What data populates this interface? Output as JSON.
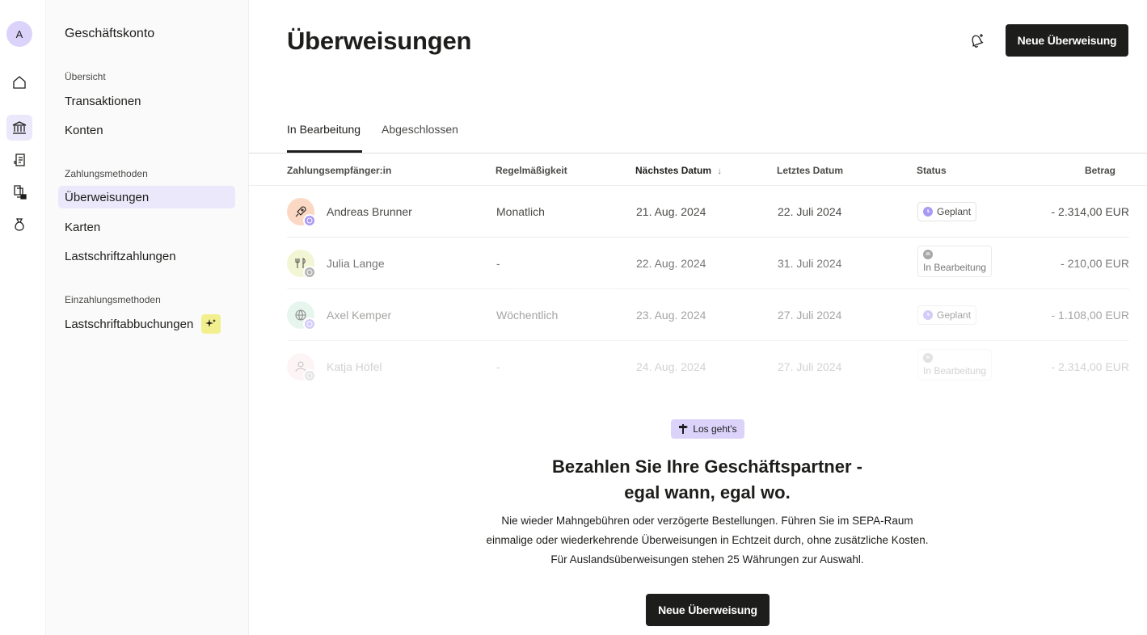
{
  "rail": {
    "avatar_initial": "A",
    "items": [
      {
        "name": "home-icon",
        "active": false
      },
      {
        "name": "bank-icon",
        "active": true
      },
      {
        "name": "invoice-icon",
        "active": false
      },
      {
        "name": "documents-lock-icon",
        "active": false
      },
      {
        "name": "money-bag-icon",
        "active": false
      }
    ]
  },
  "sidebar": {
    "title": "Geschäftskonto",
    "section_overview": "Übersicht",
    "item_transactions": "Transaktionen",
    "item_accounts": "Konten",
    "section_payment": "Zahlungsmethoden",
    "item_transfers": "Überweisungen",
    "item_cards": "Karten",
    "item_direct_debits": "Lastschriftzahlungen",
    "section_deposit": "Einzahlungsmethoden",
    "item_debit_collections": "Lastschriftabbuchungen",
    "new_badge_icon": "sparkle-icon"
  },
  "header": {
    "title": "Überweisungen",
    "new_transfer_label": "Neue Überweisung",
    "bell_icon": "bell-plus-icon"
  },
  "tabs": {
    "in_progress": "In Bearbeitung",
    "completed": "Abgeschlossen"
  },
  "table": {
    "columns": {
      "recipient": "Zahlungsempfänger:in",
      "frequency": "Regelmäßigkeit",
      "next_date": "Nächstes Datum",
      "sort_indicator": "↓",
      "last_date": "Letztes Datum",
      "status": "Status",
      "amount": "Betrag"
    },
    "rows": [
      {
        "name": "Andreas Brunner",
        "frequency": "Monatlich",
        "next": "21. Aug. 2024",
        "last": "22. Juli 2024",
        "status": "Geplant",
        "amount": "- 2.314,00 EUR"
      },
      {
        "name": "Julia Lange",
        "frequency": "-",
        "next": "22. Aug. 2024",
        "last": "31. Juli 2024",
        "status": "In Bearbeitung",
        "amount": "- 210,00 EUR"
      },
      {
        "name": "Axel Kemper",
        "frequency": "Wöchentlich",
        "next": "23. Aug. 2024",
        "last": "27. Juli 2024",
        "status": "Geplant",
        "amount": "- 1.108,00 EUR"
      },
      {
        "name": "Katja Höfel",
        "frequency": "-",
        "next": "24. Aug. 2024",
        "last": "27. Juli 2024",
        "status": "In Bearbeitung",
        "amount": "- 2.314,00 EUR"
      }
    ]
  },
  "promo": {
    "chip": "Los geht's",
    "title_line1": "Bezahlen Sie Ihre Geschäftspartner -",
    "title_line2": "egal wann, egal wo.",
    "text": "Nie wieder Mahngebühren oder verzögerte Bestellungen. Führen Sie im SEPA-Raum einmalige oder wiederkehrende Überweisungen in Echtzeit durch, ohne zusätzliche Kosten. Für Auslandsüberweisungen stehen 25 Währungen zur Auswahl.",
    "button": "Neue Überweisung"
  },
  "colors": {
    "accent_lilac": "#dcd3fb",
    "active_bg": "#ece8fb",
    "dark_button": "#1d1d1b",
    "new_badge": "#f2f08e"
  }
}
